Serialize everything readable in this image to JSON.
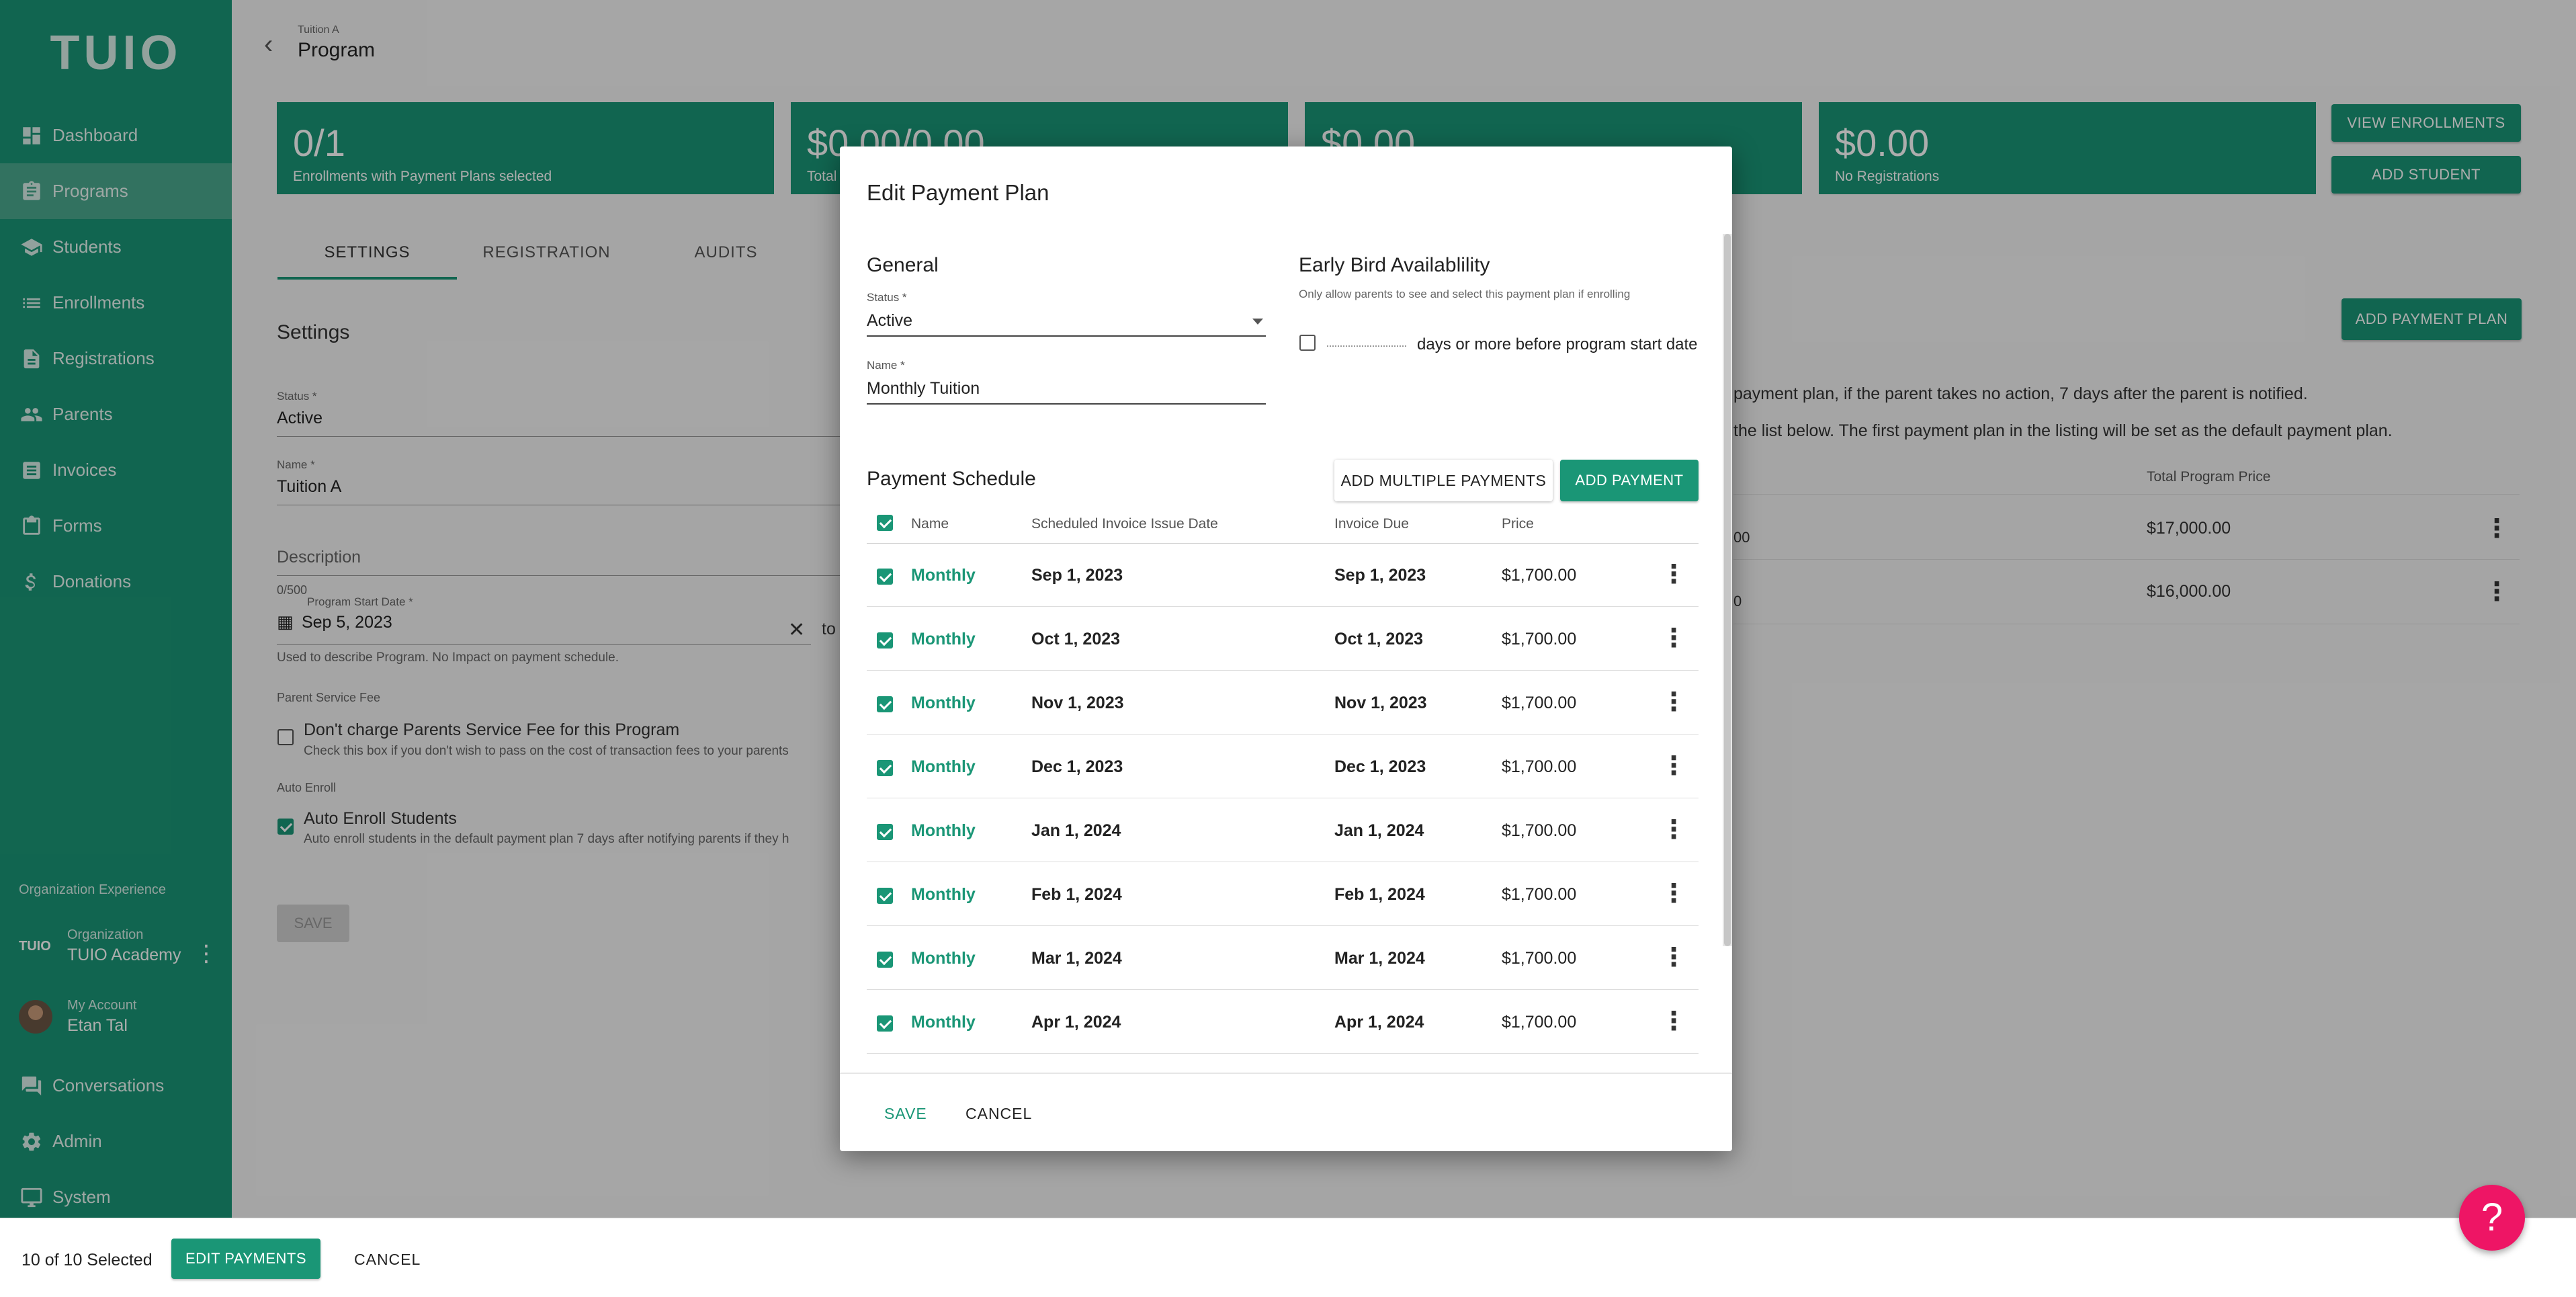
{
  "sidebar": {
    "logo": "TUIO",
    "items": [
      {
        "label": "Dashboard",
        "icon": "dashboard-icon"
      },
      {
        "label": "Programs",
        "icon": "clipboard-icon",
        "active": true
      },
      {
        "label": "Students",
        "icon": "school-icon"
      },
      {
        "label": "Enrollments",
        "icon": "list-icon"
      },
      {
        "label": "Registrations",
        "icon": "document-icon"
      },
      {
        "label": "Parents",
        "icon": "people-icon"
      },
      {
        "label": "Invoices",
        "icon": "invoice-icon"
      },
      {
        "label": "Forms",
        "icon": "clipboard-icon"
      },
      {
        "label": "Donations",
        "icon": "dollar-icon"
      }
    ],
    "org_experience": "Organization Experience",
    "org_label": "Organization",
    "org_name": "TUIO Academy",
    "org_logo": "TUIO",
    "account_label": "My Account",
    "account_name": "Etan Tal",
    "bottom_items": [
      {
        "label": "Conversations",
        "icon": "chat-icon"
      },
      {
        "label": "Admin",
        "icon": "gear-icon"
      },
      {
        "label": "System",
        "icon": "monitor-icon"
      }
    ]
  },
  "header": {
    "crumb": "Tuition A",
    "title": "Program"
  },
  "stats": [
    {
      "value": "0/1",
      "label": "Enrollments with Payment Plans selected"
    },
    {
      "value": "$0.00/0.00",
      "label": "Total"
    },
    {
      "value": "$0.00",
      "label": ""
    },
    {
      "value": "$0.00",
      "label": "No Registrations"
    }
  ],
  "actions": {
    "view_enrollments": "VIEW ENROLLMENTS",
    "add_student": "ADD STUDENT",
    "add_payment_plan": "ADD PAYMENT PLAN"
  },
  "tabs": [
    "SETTINGS",
    "REGISTRATION",
    "AUDITS"
  ],
  "settings": {
    "title": "Settings",
    "status_label": "Status *",
    "status_value": "Active",
    "name_label": "Name *",
    "name_value": "Tuition A",
    "description_placeholder": "Description",
    "char_count": "0/500",
    "start_label": "Program Start Date *",
    "start_value": "Sep 5, 2023",
    "to_text": "to",
    "date_help": "Used to describe Program. No Impact on payment schedule.",
    "service_fee_label": "Parent Service Fee",
    "service_fee_title": "Don't charge Parents Service Fee for this Program",
    "service_fee_help": "Check this box if you don't wish to pass on the cost of transaction fees to your parents",
    "auto_enroll_label": "Auto Enroll",
    "auto_enroll_title": "Auto Enroll Students",
    "auto_enroll_help": "Auto enroll students in the default payment plan 7 days after notifying parents if they h",
    "save": "SAVE"
  },
  "plans_bg": {
    "text1": "payment plan, if the parent takes no action, 7 days after the parent is notified.",
    "text2": "the list below. The first payment plan in the listing will be set as the default payment plan.",
    "col_total": "Total Program Price",
    "rows": [
      {
        "partial": "00",
        "total": "$17,000.00"
      },
      {
        "partial": "0",
        "total": "$16,000.00"
      }
    ]
  },
  "modal": {
    "title": "Edit Payment Plan",
    "general": "General",
    "status_label": "Status *",
    "status_value": "Active",
    "name_label": "Name *",
    "name_value": "Monthly Tuition",
    "early_bird_title": "Early Bird Availablility",
    "early_bird_sub": "Only allow parents to see and select this payment plan if enrolling",
    "early_bird_days_text": "days or more before program start date",
    "schedule_title": "Payment Schedule",
    "add_multiple": "ADD MULTIPLE PAYMENTS",
    "add_payment": "ADD PAYMENT",
    "columns": {
      "name": "Name",
      "issue": "Scheduled Invoice Issue Date",
      "due": "Invoice Due",
      "price": "Price"
    },
    "rows": [
      {
        "name": "Monthly",
        "issue": "Sep 1, 2023",
        "due": "Sep 1, 2023",
        "price": "$1,700.00"
      },
      {
        "name": "Monthly",
        "issue": "Oct 1, 2023",
        "due": "Oct 1, 2023",
        "price": "$1,700.00"
      },
      {
        "name": "Monthly",
        "issue": "Nov 1, 2023",
        "due": "Nov 1, 2023",
        "price": "$1,700.00"
      },
      {
        "name": "Monthly",
        "issue": "Dec 1, 2023",
        "due": "Dec 1, 2023",
        "price": "$1,700.00"
      },
      {
        "name": "Monthly",
        "issue": "Jan 1, 2024",
        "due": "Jan 1, 2024",
        "price": "$1,700.00"
      },
      {
        "name": "Monthly",
        "issue": "Feb 1, 2024",
        "due": "Feb 1, 2024",
        "price": "$1,700.00"
      },
      {
        "name": "Monthly",
        "issue": "Mar 1, 2024",
        "due": "Mar 1, 2024",
        "price": "$1,700.00"
      },
      {
        "name": "Monthly",
        "issue": "Apr 1, 2024",
        "due": "Apr 1, 2024",
        "price": "$1,700.00"
      }
    ],
    "save": "SAVE",
    "cancel": "CANCEL"
  },
  "bottombar": {
    "selected": "10 of 10 Selected",
    "edit_payments": "EDIT PAYMENTS",
    "cancel": "CANCEL"
  },
  "help_fab": "?",
  "colors": {
    "brand": "#1a9676",
    "fab": "#ee1565"
  }
}
